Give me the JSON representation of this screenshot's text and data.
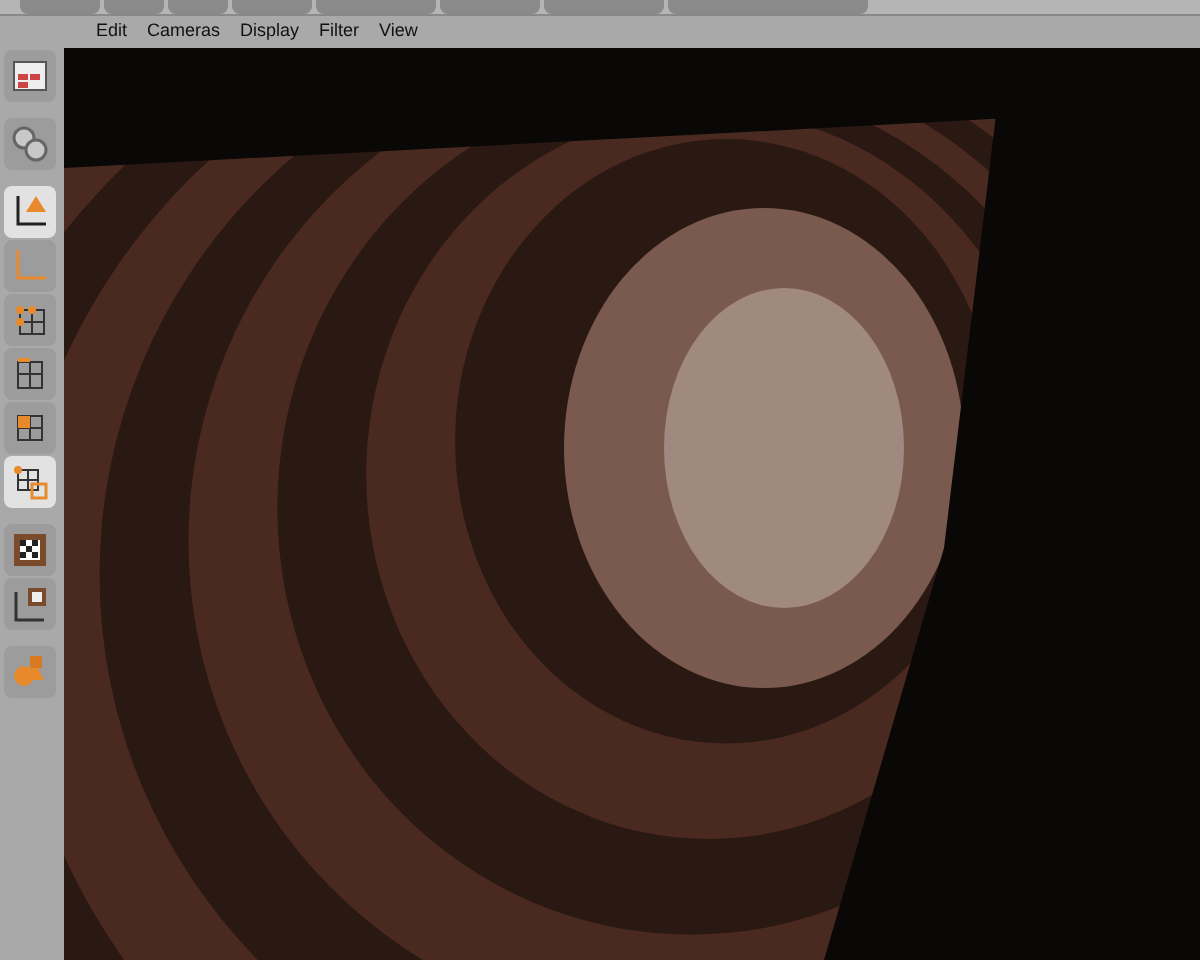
{
  "menu": [
    {
      "label": "Edit"
    },
    {
      "label": "Cameras"
    },
    {
      "label": "Display"
    },
    {
      "label": "Filter"
    },
    {
      "label": "View"
    }
  ],
  "tools": [
    {
      "kind": "layout",
      "selected": false
    },
    {
      "kind": "gap"
    },
    {
      "kind": "sculpt",
      "selected": false
    },
    {
      "kind": "gap"
    },
    {
      "kind": "model",
      "selected": true
    },
    {
      "kind": "object",
      "selected": false
    },
    {
      "kind": "points",
      "selected": false
    },
    {
      "kind": "edges",
      "selected": false
    },
    {
      "kind": "polygons",
      "selected": false
    },
    {
      "kind": "uvpoints",
      "selected": true
    },
    {
      "kind": "gap"
    },
    {
      "kind": "texture",
      "selected": false
    },
    {
      "kind": "texaxis",
      "selected": false
    },
    {
      "kind": "gap"
    },
    {
      "kind": "primitives",
      "selected": false
    }
  ]
}
